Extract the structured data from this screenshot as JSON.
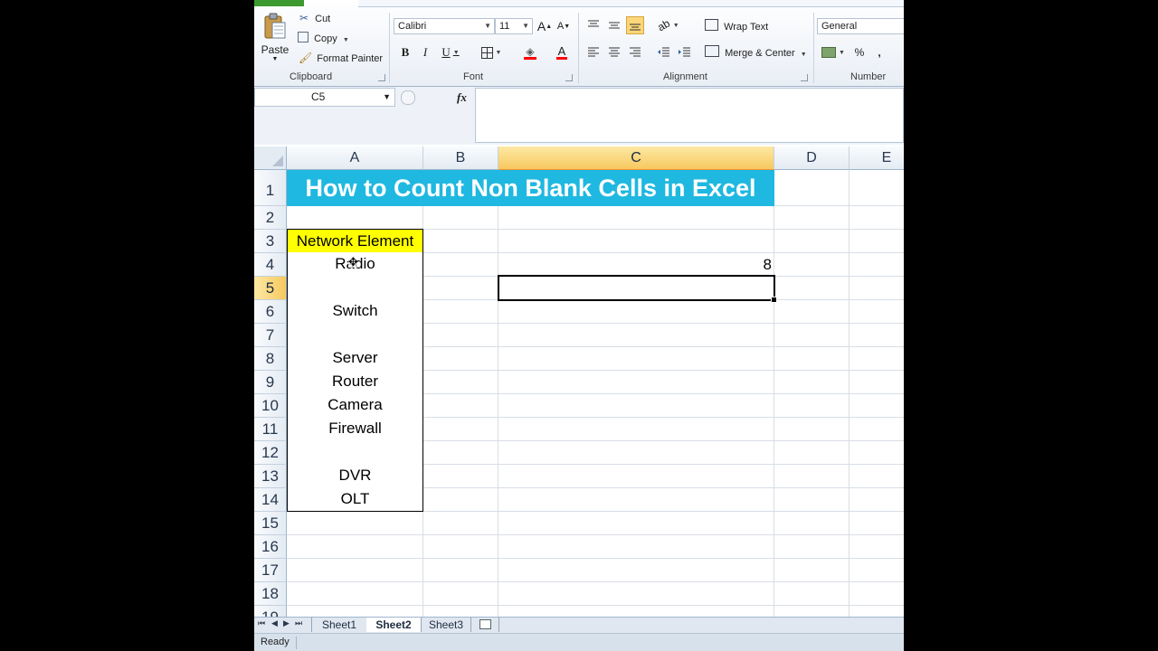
{
  "ribbon": {
    "clipboard": {
      "paste_label": "Paste",
      "cut_label": "Cut",
      "copy_label": "Copy",
      "format_painter_label": "Format Painter",
      "group_label": "Clipboard"
    },
    "font": {
      "font_name": "Calibri",
      "font_size": "11",
      "bold": "B",
      "italic": "I",
      "underline": "U",
      "group_label": "Font"
    },
    "alignment": {
      "wrap_text_label": "Wrap Text",
      "merge_center_label": "Merge & Center",
      "group_label": "Alignment"
    },
    "number": {
      "format_value": "General",
      "percent": "%",
      "comma": ",",
      "group_label": "Number"
    }
  },
  "formula_bar": {
    "name_box": "C5",
    "fx": "fx",
    "formula": ""
  },
  "grid": {
    "columns": [
      "A",
      "B",
      "C",
      "D",
      "E"
    ],
    "rows": [
      "1",
      "2",
      "3",
      "4",
      "5",
      "6",
      "7",
      "8",
      "9",
      "10",
      "11",
      "12",
      "13",
      "14",
      "15",
      "16",
      "17",
      "18",
      "19"
    ],
    "title": "How to Count Non Blank Cells in Excel",
    "list_header": "Network Element",
    "list_items": [
      "Radio",
      "",
      "Switch",
      "",
      "Server",
      "Router",
      "Camera",
      "Firewall",
      "",
      "DVR",
      "OLT"
    ],
    "result_value": "8",
    "selected_cell": "C5"
  },
  "sheets": {
    "tabs": [
      "Sheet1",
      "Sheet2",
      "Sheet3"
    ],
    "active": "Sheet2"
  },
  "status": {
    "text": "Ready"
  },
  "colors": {
    "title_bg": "#1fb8e0",
    "header_bg": "#ffff00",
    "selected_header": "#f7c85f"
  }
}
